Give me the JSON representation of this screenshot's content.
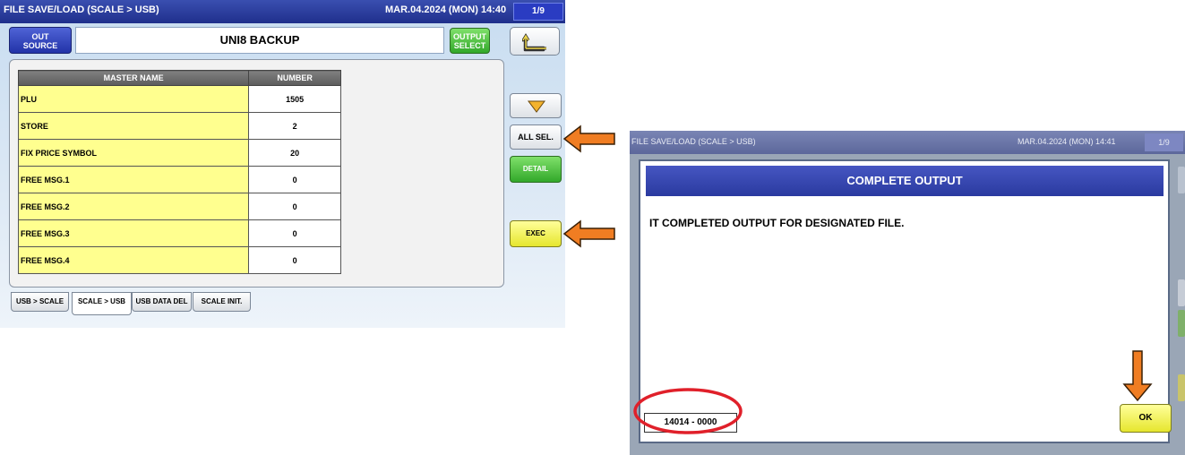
{
  "screen1": {
    "title": "FILE SAVE/LOAD (SCALE > USB)",
    "datetime": "MAR.04.2024 (MON) 14:40",
    "page": "1/9",
    "out_source_line1": "OUT",
    "out_source_line2": "SOURCE",
    "source_name": "UNI8 BACKUP",
    "output_select_line1": "OUTPUT",
    "output_select_line2": "SELECT",
    "table": {
      "headers": [
        "MASTER NAME",
        "NUMBER"
      ],
      "rows": [
        {
          "name": "PLU",
          "number": "1505"
        },
        {
          "name": "STORE",
          "number": "2"
        },
        {
          "name": "FIX PRICE SYMBOL",
          "number": "20"
        },
        {
          "name": "FREE MSG.1",
          "number": "0"
        },
        {
          "name": "FREE MSG.2",
          "number": "0"
        },
        {
          "name": "FREE MSG.3",
          "number": "0"
        },
        {
          "name": "FREE MSG.4",
          "number": "0"
        }
      ]
    },
    "buttons": {
      "all_sel": "ALL SEL.",
      "detail": "DETAIL",
      "exec": "EXEC"
    },
    "tabs": [
      "USB > SCALE",
      "SCALE > USB",
      "USB DATA DEL",
      "SCALE INIT."
    ],
    "active_tab": "SCALE > USB"
  },
  "screen2": {
    "title": "FILE SAVE/LOAD (SCALE > USB)",
    "datetime": "MAR.04.2024 (MON) 14:41",
    "page": "1/9",
    "dialog_title": "COMPLETE OUTPUT",
    "message": "IT COMPLETED OUTPUT FOR DESIGNATED FILE.",
    "code": "14014 - 0000",
    "ok_label": "OK"
  },
  "annotations": {
    "arrow_color": "#f07d22",
    "highlight_color": "#e0202a"
  }
}
